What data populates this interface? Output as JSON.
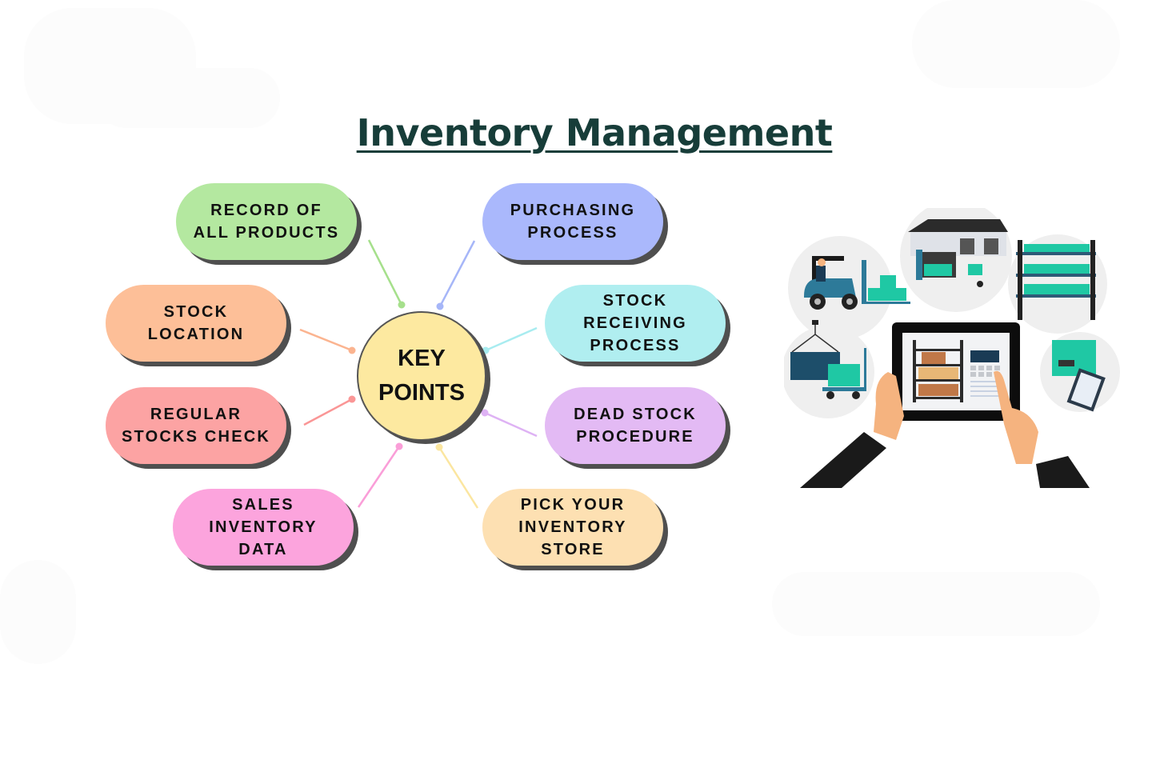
{
  "title": "Inventory Management",
  "center": {
    "label": "KEY\nPOINTS",
    "color": "#fde9a0"
  },
  "nodes": [
    {
      "id": "record-of-all-products",
      "label": "RECORD OF\nALL PRODUCTS",
      "color": "#b4e8a0",
      "line": "#a6e08c"
    },
    {
      "id": "purchasing-process",
      "label": "PURCHASING\nPROCESS",
      "color": "#aab8fc",
      "line": "#a6b6f8"
    },
    {
      "id": "stock-location",
      "label": "STOCK\nLOCATION",
      "color": "#fdbf98",
      "line": "#fbb490"
    },
    {
      "id": "stock-receiving-process",
      "label": "STOCK\nRECEIVING\nPROCESS",
      "color": "#b0eef0",
      "line": "#a8ecf0"
    },
    {
      "id": "regular-stocks-check",
      "label": "REGULAR\nSTOCKS CHECK",
      "color": "#fca3a3",
      "line": "#fa9696"
    },
    {
      "id": "dead-stock-procedure",
      "label": "DEAD STOCK\nPROCEDURE",
      "color": "#e3baf4",
      "line": "#deb2f4"
    },
    {
      "id": "sales-inventory-data",
      "label": "SALES\nINVENTORY\nDATA",
      "color": "#fca4dd",
      "line": "#fa9ed8"
    },
    {
      "id": "pick-your-inventory-store",
      "label": "PICK YOUR\nINVENTORY\nSTORE",
      "color": "#fde0b2",
      "line": "#fbe6a0"
    }
  ],
  "illustration": {
    "subject": "hands holding tablet with warehouse inventory app",
    "scenes": [
      "forklift-with-boxes",
      "warehouse-loading-truck",
      "storage-racks",
      "container-crane-cart",
      "package-checklist"
    ],
    "palette": {
      "teal": "#1fc8a4",
      "navy": "#1a4a66",
      "blue": "#2d7a99",
      "skin": "#f5b37f",
      "suit": "#1a1a1a",
      "box": "#c07848"
    }
  }
}
